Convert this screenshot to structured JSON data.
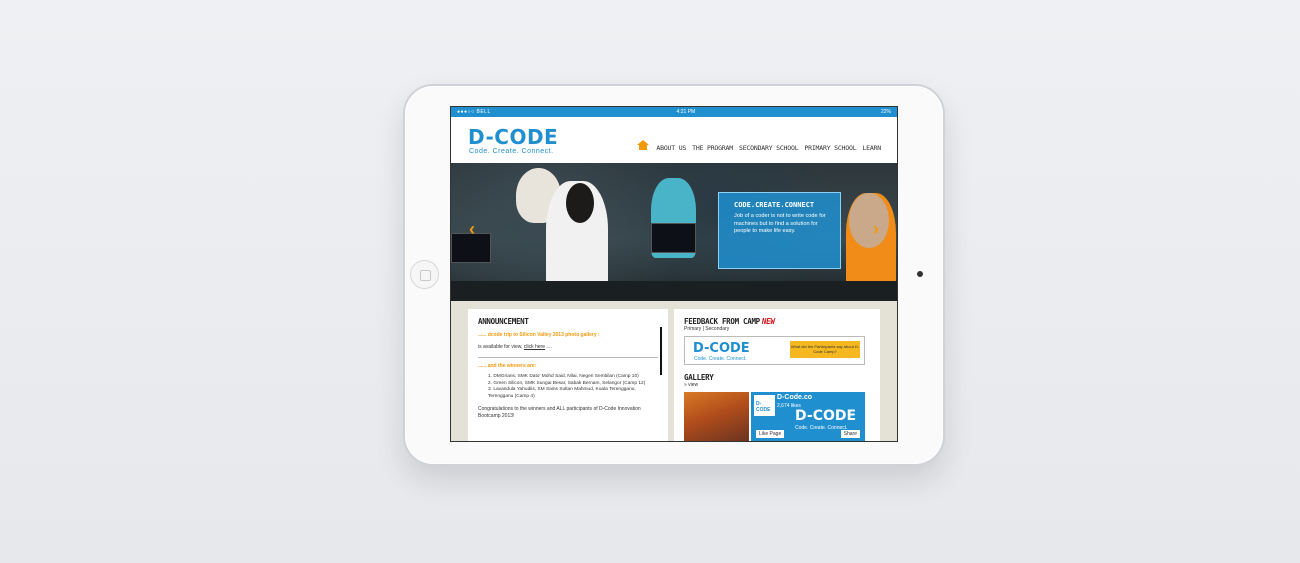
{
  "statusbar": {
    "carrier": "●●●○○ BELL",
    "time": "4:21 PM",
    "battery": "22%"
  },
  "site": {
    "logo": "D-CODE",
    "tagline": "Code. Create. Connect."
  },
  "nav": {
    "home_icon": "home-icon",
    "items": [
      {
        "label": "ABOUT US"
      },
      {
        "label": "THE PROGRAM"
      },
      {
        "label": "SECONDARY SCHOOL"
      },
      {
        "label": "PRIMARY SCHOOL"
      },
      {
        "label": "LEARN"
      }
    ]
  },
  "hero": {
    "overlay_title": "CODE.CREATE.CONNECT",
    "overlay_text": "Job of a coder is not to write code for machines but to find a solution for people to make life easy.",
    "prev_arrow": "‹",
    "next_arrow": "›"
  },
  "announcement": {
    "title": "ANNOUNCEMENT",
    "item1": "...... dcode trip to Silicon Valley 2013 photo gallery :",
    "item1_text": "is available for view,",
    "item1_link": "click here",
    "item1_suffix": "....",
    "item2": "...... and the winners are:",
    "winners": [
      "1. DMGrians, SMK Dato' Mohd Said, Nilai, Negeri Sembilan (Camp 10)",
      "2. Green Silicon, SMK Sungai Besar, Sabak Bernam, Selangor (Camp 12)",
      "3. Lavandula Yahudiis, SM Sains Sultan Mahmud, Kuala Terengganu, Terengganu (Camp 4)"
    ],
    "congrats": "Congratulations to the winners and ALL participants of D-Code Innovation Bootcamp 2013!"
  },
  "feedback": {
    "title": "FEEDBACK FROM CAMP",
    "new_badge": "NEW",
    "links": "Primary | Secondary",
    "banner_logo": "D-CODE",
    "banner_tag": "Code. Create. Connect.",
    "banner_ribbon": "What did the Participants say about D-Code Camp?"
  },
  "gallery": {
    "title": "GALLERY",
    "view": "» view",
    "fb_name": "D-Code.co",
    "fb_likes": "2,674 likes",
    "fb_logo": "D-CODE",
    "fb_big": "D-CODE",
    "fb_tag": "Code. Create. Connect.",
    "fb_like_btn": "Like Page",
    "fb_share_btn": "Share"
  }
}
